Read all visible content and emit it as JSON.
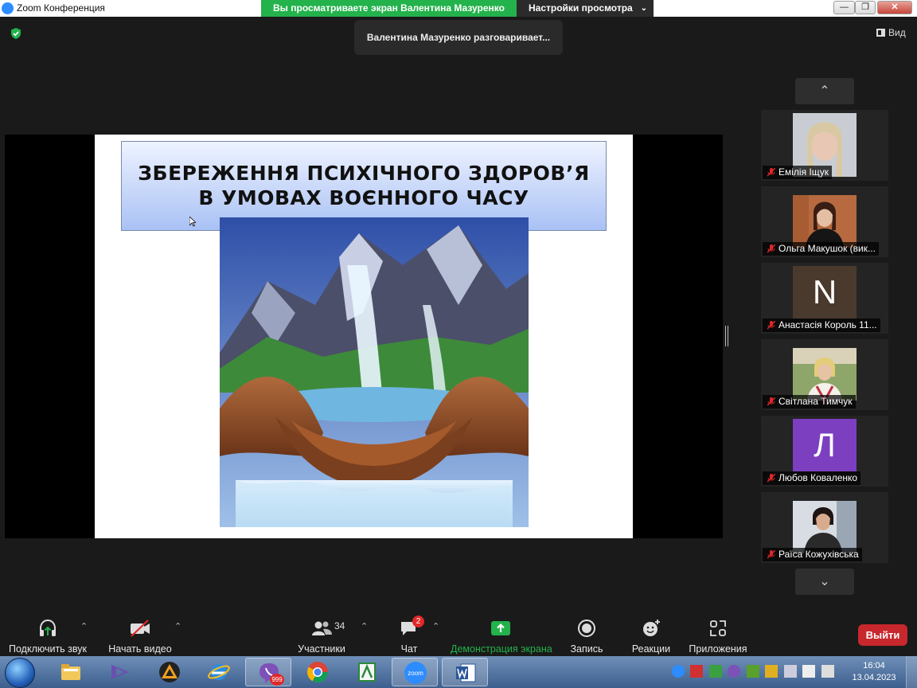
{
  "window": {
    "title": "Zoom Конференция",
    "share_banner": "Вы просматриваете экран Валентина Мазуренко",
    "view_settings": "Настройки просмотра"
  },
  "overlay": {
    "talking": "Валентина Мазуренко разговаривает...",
    "view_label": "Вид"
  },
  "slide": {
    "title_line1": "ЗБЕРЕЖЕННЯ ПСИХІЧНОГО ЗДОРОВ’Я",
    "title_line2": "В УМОВАХ ВОЄННОГО ЧАСУ"
  },
  "participants": [
    {
      "name": "Емілія Іщук",
      "muted": true,
      "type": "photo",
      "icon": "avatar-photo"
    },
    {
      "name": "Ольга Макушок (вик...",
      "muted": true,
      "type": "photo",
      "icon": "avatar-photo"
    },
    {
      "name": "Анастасія Король 11...",
      "muted": true,
      "type": "letter",
      "letter": "N",
      "color": "#4a3a2e"
    },
    {
      "name": "Світлана Тимчук",
      "muted": true,
      "type": "photo",
      "icon": "avatar-photo"
    },
    {
      "name": "Любов Коваленко",
      "muted": true,
      "type": "letter",
      "letter": "Л",
      "color": "#7b3fc0"
    },
    {
      "name": "Раїса Кожухівська",
      "muted": true,
      "type": "photo",
      "icon": "avatar-photo"
    }
  ],
  "toolbar": {
    "audio": "Подключить звук",
    "video": "Начать видео",
    "participants": "Участники",
    "participants_count": "34",
    "chat": "Чат",
    "chat_unread": "2",
    "share": "Демонстрация экрана",
    "record": "Запись",
    "reactions": "Реакции",
    "apps": "Приложения",
    "leave": "Выйти"
  },
  "taskbar": {
    "viber_badge": "999",
    "zoom_label": "zoom",
    "time": "16:04",
    "date": "13.04.2023"
  },
  "colors": {
    "share_green": "#23b24b",
    "leave_red": "#c8272d",
    "zoom_blue": "#2d8cff"
  }
}
